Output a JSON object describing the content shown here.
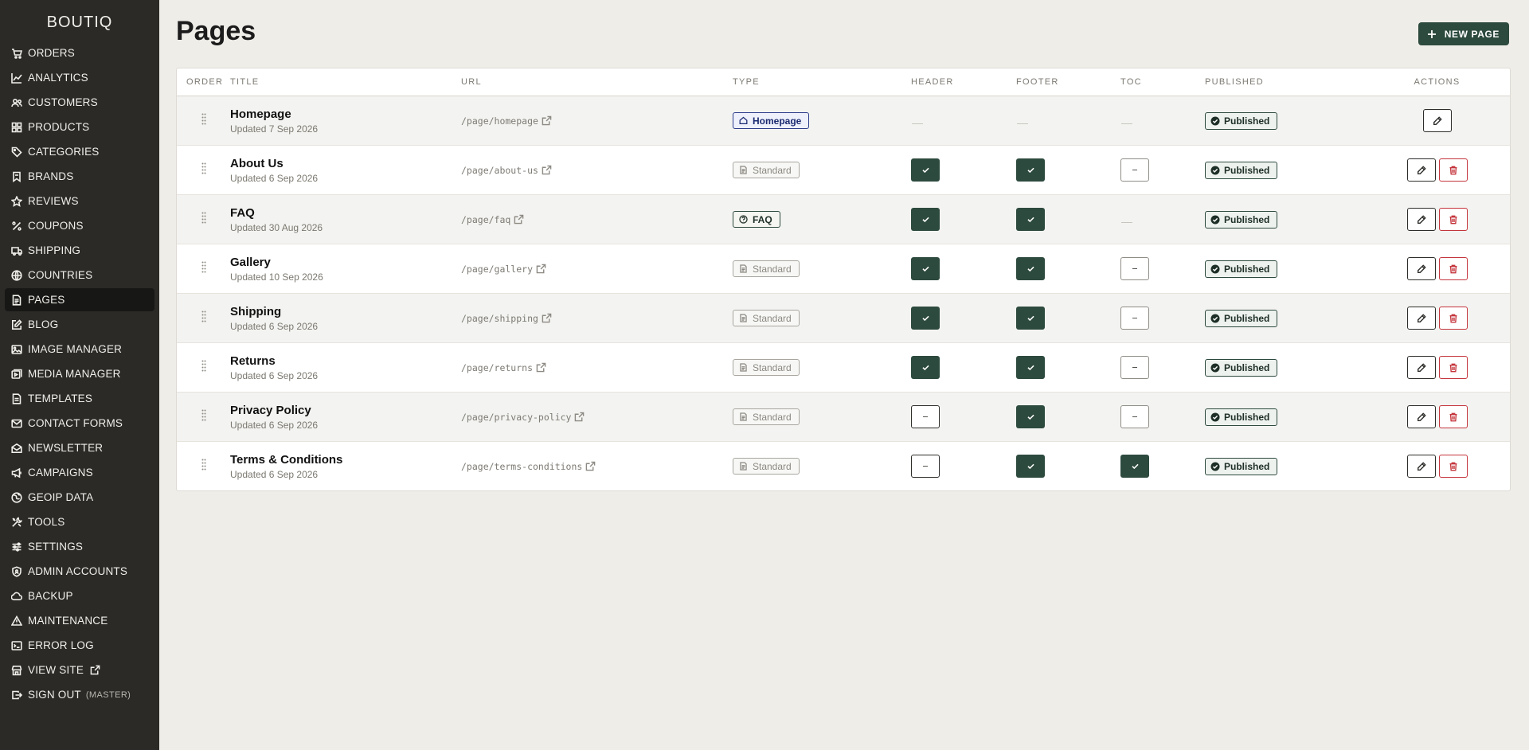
{
  "brand": "BOUTIQ",
  "sidebar": {
    "items": [
      {
        "label": "ORDERS",
        "icon": "cart-icon"
      },
      {
        "label": "ANALYTICS",
        "icon": "chart-line-icon"
      },
      {
        "label": "CUSTOMERS",
        "icon": "users-icon"
      },
      {
        "label": "PRODUCTS",
        "icon": "grid-icon"
      },
      {
        "label": "CATEGORIES",
        "icon": "tag-icon"
      },
      {
        "label": "BRANDS",
        "icon": "bookmark-icon"
      },
      {
        "label": "REVIEWS",
        "icon": "star-icon"
      },
      {
        "label": "COUPONS",
        "icon": "percent-icon"
      },
      {
        "label": "SHIPPING",
        "icon": "truck-icon"
      },
      {
        "label": "COUNTRIES",
        "icon": "globe-icon"
      },
      {
        "label": "PAGES",
        "icon": "document-icon",
        "active": true
      },
      {
        "label": "BLOG",
        "icon": "edit-icon"
      },
      {
        "label": "IMAGE MANAGER",
        "icon": "image-icon"
      },
      {
        "label": "MEDIA MANAGER",
        "icon": "media-icon"
      },
      {
        "label": "TEMPLATES",
        "icon": "template-icon"
      },
      {
        "label": "CONTACT FORMS",
        "icon": "mail-icon"
      },
      {
        "label": "NEWSLETTER",
        "icon": "newsletter-icon"
      },
      {
        "label": "CAMPAIGNS",
        "icon": "megaphone-icon"
      },
      {
        "label": "GEOIP DATA",
        "icon": "globe-pin-icon"
      },
      {
        "label": "TOOLS",
        "icon": "tools-icon"
      },
      {
        "label": "SETTINGS",
        "icon": "sliders-icon"
      },
      {
        "label": "ADMIN ACCOUNTS",
        "icon": "shield-icon"
      },
      {
        "label": "BACKUP",
        "icon": "cloud-icon"
      },
      {
        "label": "MAINTENANCE",
        "icon": "warning-icon"
      },
      {
        "label": "ERROR LOG",
        "icon": "terminal-icon"
      },
      {
        "label": "VIEW SITE",
        "icon": "store-icon"
      },
      {
        "label": "SIGN OUT",
        "icon": "logout-icon",
        "sub": "(MASTER)"
      }
    ]
  },
  "header": {
    "title": "Pages",
    "new_button_label": "NEW PAGE"
  },
  "table": {
    "columns": {
      "order": "ORDER",
      "title": "TITLE",
      "url": "URL",
      "type": "TYPE",
      "header": "HEADER",
      "footer": "FOOTER",
      "toc": "TOC",
      "published": "PUBLISHED",
      "actions": "ACTIONS"
    },
    "rows": [
      {
        "title": "Homepage",
        "updated": "Updated 7 Sep 2026",
        "url": "/page/homepage",
        "type": "Homepage",
        "type_style": "home",
        "header": null,
        "footer": null,
        "toc": null,
        "published": "Published",
        "deletable": false
      },
      {
        "title": "About Us",
        "updated": "Updated 6 Sep 2026",
        "url": "/page/about-us",
        "type": "Standard",
        "type_style": "std",
        "header": true,
        "footer": true,
        "toc": false,
        "published": "Published",
        "deletable": true
      },
      {
        "title": "FAQ",
        "updated": "Updated 30 Aug 2026",
        "url": "/page/faq",
        "type": "FAQ",
        "type_style": "faq",
        "header": true,
        "footer": true,
        "toc": null,
        "published": "Published",
        "deletable": true
      },
      {
        "title": "Gallery",
        "updated": "Updated 10 Sep 2026",
        "url": "/page/gallery",
        "type": "Standard",
        "type_style": "std",
        "header": true,
        "footer": true,
        "toc": false,
        "published": "Published",
        "deletable": true
      },
      {
        "title": "Shipping",
        "updated": "Updated 6 Sep 2026",
        "url": "/page/shipping",
        "type": "Standard",
        "type_style": "std",
        "header": true,
        "footer": true,
        "toc": false,
        "published": "Published",
        "deletable": true
      },
      {
        "title": "Returns",
        "updated": "Updated 6 Sep 2026",
        "url": "/page/returns",
        "type": "Standard",
        "type_style": "std",
        "header": true,
        "footer": true,
        "toc": false,
        "published": "Published",
        "deletable": true
      },
      {
        "title": "Privacy Policy",
        "updated": "Updated 6 Sep 2026",
        "url": "/page/privacy-policy",
        "type": "Standard",
        "type_style": "std",
        "header": false,
        "footer": true,
        "toc": false,
        "published": "Published",
        "deletable": true
      },
      {
        "title": "Terms & Conditions",
        "updated": "Updated 6 Sep 2026",
        "url": "/page/terms-conditions",
        "type": "Standard",
        "type_style": "std",
        "header": false,
        "footer": true,
        "toc": true,
        "published": "Published",
        "deletable": true
      }
    ]
  },
  "colors": {
    "sidebar_bg": "#2b2a27",
    "accent_green": "#2d4a3e",
    "homepage_blue": "#2b3c8a",
    "delete_red": "#c4343b",
    "page_bg": "#efede8"
  }
}
